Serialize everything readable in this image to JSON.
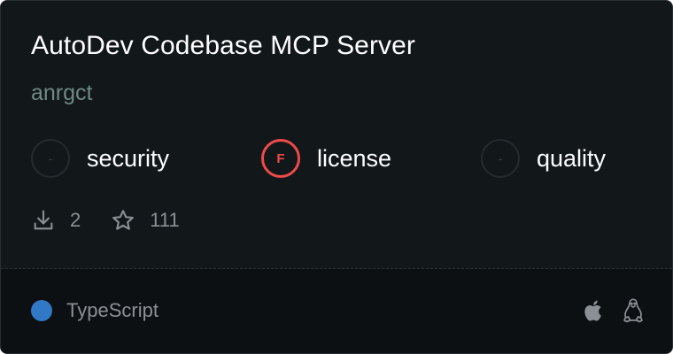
{
  "server": {
    "title": "AutoDev Codebase MCP Server",
    "author": "anrgct"
  },
  "scores": [
    {
      "label": "security",
      "grade": "-",
      "status": "none"
    },
    {
      "label": "license",
      "grade": "F",
      "status": "fail"
    },
    {
      "label": "quality",
      "grade": "-",
      "status": "none"
    }
  ],
  "stats": {
    "downloads": "2",
    "stars": "111"
  },
  "footer": {
    "language": "TypeScript",
    "language_color": "#3178c6",
    "platforms": [
      "apple-icon",
      "linux-icon"
    ]
  },
  "colors": {
    "background": "#12171a",
    "footer_background": "#0c1013",
    "fail": "#ef4a4a",
    "author": "#6f8a82"
  }
}
